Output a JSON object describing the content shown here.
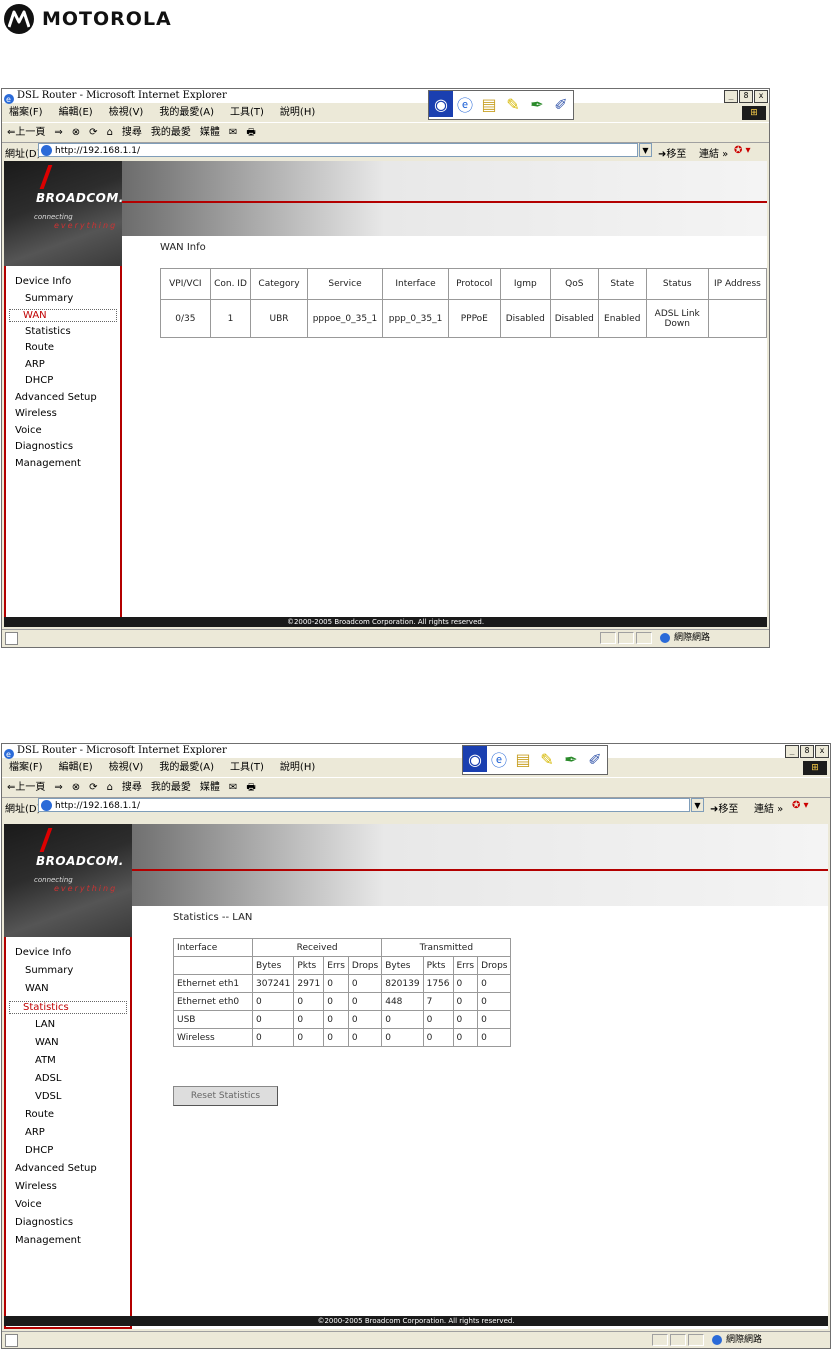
{
  "brand": {
    "name": "MOTOROLA"
  },
  "browser": {
    "title": "DSL Router - Microsoft Internet Explorer",
    "window_controls": [
      "_",
      "8",
      "x"
    ],
    "menu": [
      "檔案(F)",
      "編輯(E)",
      "檢視(V)",
      "我的最愛(A)",
      "工具(T)",
      "說明(H)"
    ],
    "toolbar": [
      "⇐上一頁",
      "⇒",
      "⊗",
      "⟳",
      "⌂",
      "搜尋",
      "我的最愛",
      "媒體",
      "✉",
      "🖶"
    ],
    "address_label": "網址(D)",
    "go_label": "移至",
    "links_label": "連結",
    "quick_launch_icons": [
      "media-player-icon",
      "ie-icon",
      "folder-icon",
      "notepad-icon",
      "pen-icon",
      "note-icon"
    ]
  },
  "screen1": {
    "address": "http://192.168.1.1/",
    "brand": "BROADCOM.",
    "tagline": "connecting",
    "tagline2": "everything",
    "sidebar": [
      "Device Info",
      "Summary",
      "WAN",
      "Statistics",
      "Route",
      "ARP",
      "DHCP",
      "Advanced Setup",
      "Wireless",
      "Voice",
      "Diagnostics",
      "Management"
    ],
    "page_title": "WAN Info",
    "table": {
      "headers": [
        "VPI/VCI",
        "Con. ID",
        "Category",
        "Service",
        "Interface",
        "Protocol",
        "Igmp",
        "QoS",
        "State",
        "Status",
        "IP Address"
      ],
      "row": [
        "0/35",
        "1",
        "UBR",
        "pppoe_0_35_1",
        "ppp_0_35_1",
        "PPPoE",
        "Disabled",
        "Disabled",
        "Enabled",
        "ADSL Link Down",
        ""
      ]
    },
    "footer": "©2000-2005 Broadcom Corporation. All rights reserved.",
    "status_zone": "網際網路"
  },
  "screen2": {
    "address": "http://192.168.1.1/",
    "brand": "BROADCOM.",
    "tagline": "connecting",
    "tagline2": "everything",
    "sidebar": [
      "Device Info",
      "Summary",
      "WAN",
      "Statistics",
      "LAN",
      "WAN",
      "ATM",
      "ADSL",
      "VDSL",
      "Route",
      "ARP",
      "DHCP",
      "Advanced Setup",
      "Wireless",
      "Voice",
      "Diagnostics",
      "Management"
    ],
    "page_title": "Statistics -- LAN",
    "table": {
      "h1": [
        "Interface",
        "Received",
        "Transmitted"
      ],
      "h2": [
        "Bytes",
        "Pkts",
        "Errs",
        "Drops",
        "Bytes",
        "Pkts",
        "Errs",
        "Drops"
      ],
      "rows": [
        [
          "Ethernet eth1",
          "307241",
          "2971",
          "0",
          "0",
          "820139",
          "1756",
          "0",
          "0"
        ],
        [
          "Ethernet eth0",
          "0",
          "0",
          "0",
          "0",
          "448",
          "7",
          "0",
          "0"
        ],
        [
          "USB",
          "0",
          "0",
          "0",
          "0",
          "0",
          "0",
          "0",
          "0"
        ],
        [
          "Wireless",
          "0",
          "0",
          "0",
          "0",
          "0",
          "0",
          "0",
          "0"
        ]
      ]
    },
    "reset_button": "Reset Statistics",
    "footer": "©2000-2005 Broadcom Corporation. All rights reserved.",
    "status_zone": "網際網路"
  }
}
